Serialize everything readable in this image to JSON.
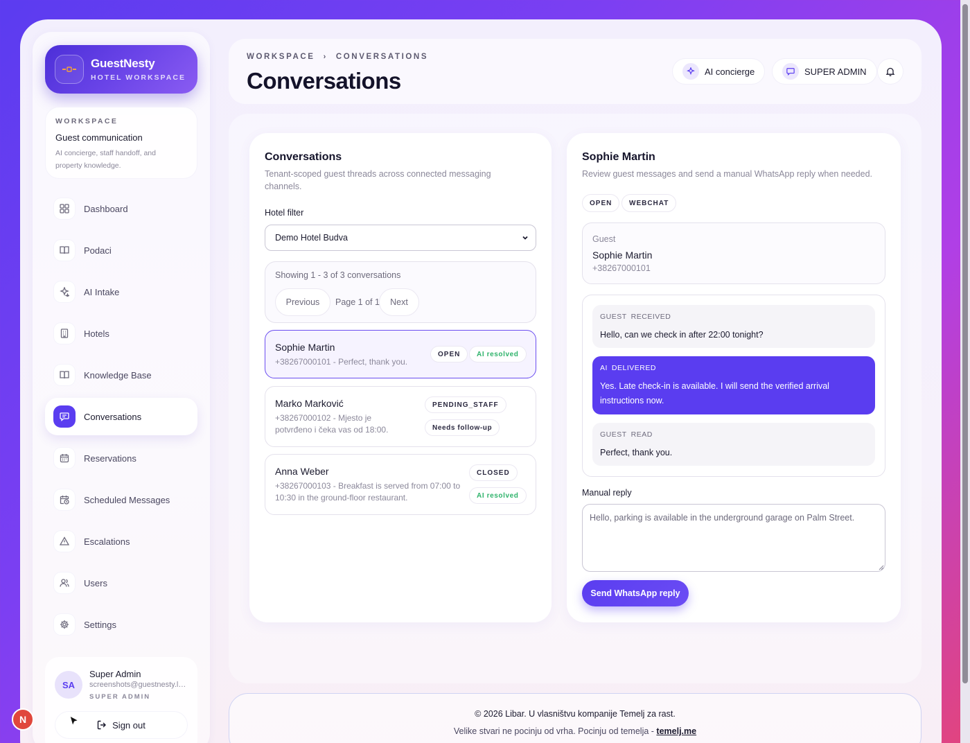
{
  "brand": {
    "name": "GuestNesty",
    "subtitle": "HOTEL WORKSPACE"
  },
  "workspace": {
    "label": "WORKSPACE",
    "title": "Guest communication",
    "description": "AI concierge, staff handoff, and property knowledge."
  },
  "nav": [
    {
      "label": "Dashboard",
      "icon": "grid-icon"
    },
    {
      "label": "Podaci",
      "icon": "book-icon"
    },
    {
      "label": "AI Intake",
      "icon": "sparkle-icon"
    },
    {
      "label": "Hotels",
      "icon": "building-icon"
    },
    {
      "label": "Knowledge Base",
      "icon": "book-open-icon"
    },
    {
      "label": "Conversations",
      "icon": "chat-icon",
      "active": true
    },
    {
      "label": "Reservations",
      "icon": "calendar-icon"
    },
    {
      "label": "Scheduled Messages",
      "icon": "calendar-clock-icon"
    },
    {
      "label": "Escalations",
      "icon": "warning-icon"
    },
    {
      "label": "Users",
      "icon": "users-icon"
    },
    {
      "label": "Settings",
      "icon": "gear-icon"
    }
  ],
  "user": {
    "initials": "SA",
    "name": "Super Admin",
    "email": "screenshots@guestnesty.local",
    "role": "SUPER ADMIN",
    "sign_out": "Sign out"
  },
  "header": {
    "breadcrumb": [
      "WORKSPACE",
      "CONVERSATIONS"
    ],
    "title": "Conversations",
    "ai_button": "AI concierge",
    "role_button": "SUPER ADMIN"
  },
  "list_panel": {
    "title": "Conversations",
    "description": "Tenant-scoped guest threads across connected messaging channels.",
    "filter_label": "Hotel filter",
    "filter_value": "Demo Hotel Budva",
    "showing": "Showing 1 - 3 of 3 conversations",
    "prev": "Previous",
    "page_info": "Page 1 of 1",
    "next": "Next",
    "conversations": [
      {
        "name": "Sophie Martin",
        "preview": "+38267000101 - Perfect, thank you.",
        "status": "OPEN",
        "resolution": "AI resolved"
      },
      {
        "name": "Marko Marković",
        "preview": "+38267000102 - Mjesto je potvrđeno i čeka vas od 18:00.",
        "status": "PENDING_STAFF",
        "resolution": "Needs follow-up"
      },
      {
        "name": "Anna Weber",
        "preview": "+38267000103 - Breakfast is served from 07:00 to 10:30 in the ground-floor restaurant.",
        "status": "CLOSED",
        "resolution": "AI resolved"
      }
    ]
  },
  "detail_panel": {
    "title": "Sophie Martin",
    "description": "Review guest messages and send a manual WhatsApp reply when needed.",
    "chips": [
      "OPEN",
      "WEBCHAT"
    ],
    "guest_label": "Guest",
    "guest_name": "Sophie Martin",
    "guest_phone": "+38267000101",
    "messages": [
      {
        "sender": "GUEST",
        "state": "RECEIVED",
        "text": "Hello, can we check in after 22:00 tonight?"
      },
      {
        "sender": "AI",
        "state": "DELIVERED",
        "text": "Yes. Late check-in is available. I will send the verified arrival instructions now."
      },
      {
        "sender": "GUEST",
        "state": "READ",
        "text": "Perfect, thank you."
      }
    ],
    "reply_label": "Manual reply",
    "reply_value": "Hello, parking is available in the underground garage on Palm Street.",
    "send_button": "Send WhatsApp reply"
  },
  "footer": {
    "line1": "© 2026 Libar. U vlasništvu kompanije Temelj za rast.",
    "line2": "Velike stvari ne pocinju od vrha. Pocinju od temelja - ",
    "link": "temelj.me"
  },
  "colors": {
    "accent": "#5a3df0",
    "success": "#2fb36b",
    "danger": "#e0473c"
  }
}
